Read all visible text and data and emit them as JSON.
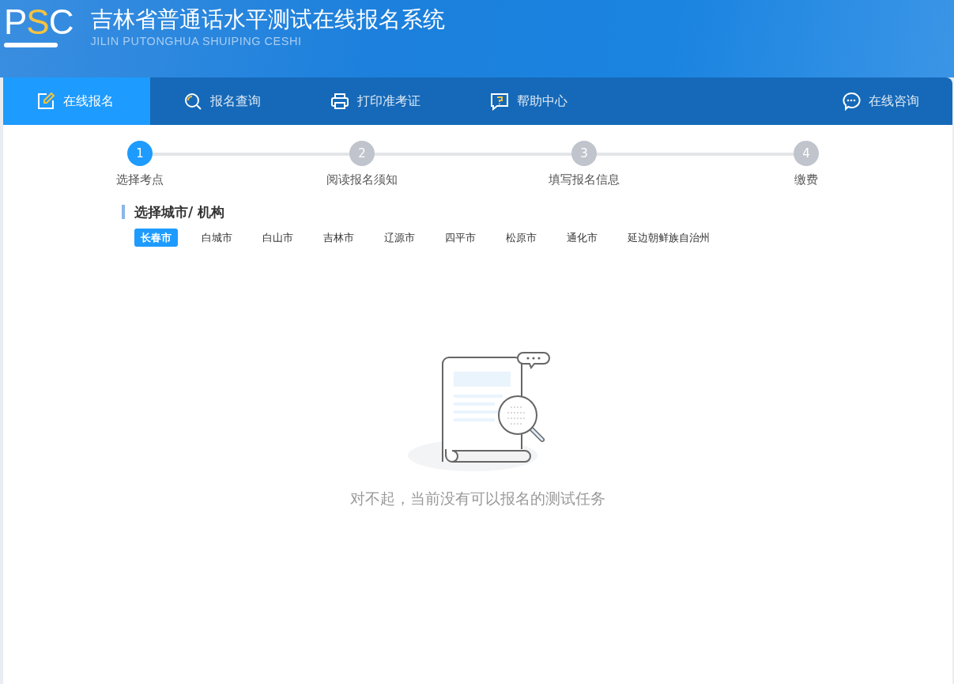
{
  "header": {
    "logo": [
      {
        "text": "P",
        "highlight": false
      },
      {
        "text": "S",
        "highlight": true
      },
      {
        "text": "C",
        "highlight": false
      }
    ],
    "title": "吉林省普通话水平测试在线报名系统",
    "subtitle": "JILIN PUTONGHUA SHUIPING CESHI"
  },
  "nav": {
    "items": [
      {
        "label": "在线报名",
        "kind": "edit",
        "selected": true
      },
      {
        "label": "报名查询",
        "kind": "search",
        "selected": false
      },
      {
        "label": "打印准考证",
        "kind": "print",
        "selected": false
      },
      {
        "label": "帮助中心",
        "kind": "help",
        "selected": false
      }
    ],
    "consult": {
      "label": "在线咨询"
    }
  },
  "steps": [
    {
      "number": "1",
      "label": "选择考点",
      "selected": true
    },
    {
      "number": "2",
      "label": "阅读报名须知",
      "selected": false
    },
    {
      "number": "3",
      "label": "填写报名信息",
      "selected": false
    },
    {
      "number": "4",
      "label": "缴费",
      "selected": false
    }
  ],
  "section_title": "选择城市/ 机构",
  "cities": [
    {
      "label": "长春市",
      "selected": true
    },
    {
      "label": "白城市",
      "selected": false
    },
    {
      "label": "白山市",
      "selected": false
    },
    {
      "label": "吉林市",
      "selected": false
    },
    {
      "label": "辽源市",
      "selected": false
    },
    {
      "label": "四平市",
      "selected": false
    },
    {
      "label": "松原市",
      "selected": false
    },
    {
      "label": "通化市",
      "selected": false
    },
    {
      "label": "延边朝鲜族自治州",
      "selected": false
    }
  ],
  "empty_message": "对不起，当前没有可以报名的测试任务"
}
